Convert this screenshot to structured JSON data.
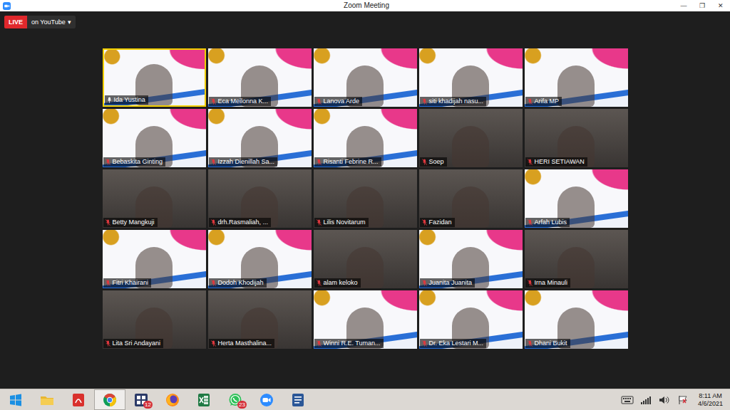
{
  "window": {
    "title": "Zoom Meeting",
    "controls": [
      "—",
      "❐",
      "✕"
    ]
  },
  "live": {
    "badge": "LIVE",
    "label": "on YouTube",
    "caret": "▾"
  },
  "participants": [
    {
      "name": "Ida Yustina",
      "muted": false,
      "speaking": true,
      "kind": "banner"
    },
    {
      "name": "Eca Meilonna K...",
      "muted": true,
      "speaking": false,
      "kind": "banner"
    },
    {
      "name": "Lanova Arde",
      "muted": true,
      "speaking": false,
      "kind": "banner"
    },
    {
      "name": "siti khadijah nasu...",
      "muted": true,
      "speaking": false,
      "kind": "banner"
    },
    {
      "name": "Arifa MP",
      "muted": true,
      "speaking": false,
      "kind": "banner"
    },
    {
      "name": "Bebaskita Ginting",
      "muted": true,
      "speaking": false,
      "kind": "banner"
    },
    {
      "name": "Izzah Dienillah Sa...",
      "muted": true,
      "speaking": false,
      "kind": "banner"
    },
    {
      "name": "Risanti Febrine R...",
      "muted": true,
      "speaking": false,
      "kind": "banner"
    },
    {
      "name": "Soep",
      "muted": true,
      "speaking": false,
      "kind": "camera"
    },
    {
      "name": "HERI SETIAWAN",
      "muted": true,
      "speaking": false,
      "kind": "camera"
    },
    {
      "name": "Betty Mangkuji",
      "muted": true,
      "speaking": false,
      "kind": "camera"
    },
    {
      "name": "drh.Rasmaliah, ...",
      "muted": true,
      "speaking": false,
      "kind": "camera"
    },
    {
      "name": "Lilis Novitarum",
      "muted": true,
      "speaking": false,
      "kind": "camera"
    },
    {
      "name": "Fazidan",
      "muted": true,
      "speaking": false,
      "kind": "camera"
    },
    {
      "name": "Arfah Lubis",
      "muted": true,
      "speaking": false,
      "kind": "banner"
    },
    {
      "name": "Fitri Khairani",
      "muted": true,
      "speaking": false,
      "kind": "banner"
    },
    {
      "name": "Dodoh Khodijah",
      "muted": true,
      "speaking": false,
      "kind": "banner"
    },
    {
      "name": "alam keloko",
      "muted": true,
      "speaking": false,
      "kind": "camera"
    },
    {
      "name": "Juanita Juanita",
      "muted": true,
      "speaking": false,
      "kind": "banner"
    },
    {
      "name": "Irna Minauli",
      "muted": true,
      "speaking": false,
      "kind": "camera"
    },
    {
      "name": "Lita Sri Andayani",
      "muted": true,
      "speaking": false,
      "kind": "camera"
    },
    {
      "name": "Herta Masthalina...",
      "muted": true,
      "speaking": false,
      "kind": "camera"
    },
    {
      "name": "Winni R.E. Tuman...",
      "muted": true,
      "speaking": false,
      "kind": "banner"
    },
    {
      "name": "Dr. Eka Lestari M...",
      "muted": true,
      "speaking": false,
      "kind": "banner"
    },
    {
      "name": "Dhani Bukit",
      "muted": true,
      "speaking": false,
      "kind": "banner"
    }
  ],
  "taskbar": {
    "apps": [
      {
        "kind": "start",
        "active": false
      },
      {
        "kind": "explorer",
        "active": false
      },
      {
        "kind": "pdf",
        "active": false
      },
      {
        "kind": "chrome",
        "active": true
      },
      {
        "kind": "grid",
        "active": false,
        "badge": "12"
      },
      {
        "kind": "firefox",
        "active": false
      },
      {
        "kind": "excel",
        "active": false
      },
      {
        "kind": "whatsapp",
        "active": false,
        "badge": "23"
      },
      {
        "kind": "zoom",
        "active": false
      },
      {
        "kind": "word",
        "active": false
      }
    ],
    "time": "8:11 AM",
    "date": "4/6/2021"
  }
}
